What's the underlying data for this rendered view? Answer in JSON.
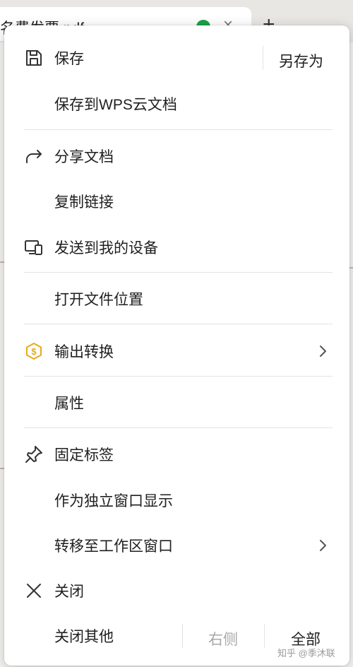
{
  "background": {
    "tab_title": "名费发票.pdf"
  },
  "menu": {
    "save": "保存",
    "save_as": "另存为",
    "save_to_cloud": "保存到WPS云文档",
    "share_doc": "分享文档",
    "copy_link": "复制链接",
    "send_to_device": "发送到我的设备",
    "open_location": "打开文件位置",
    "export_convert": "输出转换",
    "properties": "属性",
    "pin_tab": "固定标签",
    "show_independent_window": "作为独立窗口显示",
    "move_to_workspace": "转移至工作区窗口",
    "close": "关闭",
    "close_others": "关闭其他",
    "close_right": "右侧",
    "close_all": "全部"
  },
  "watermark": "知乎 @季沐联",
  "colors": {
    "accent_gold": "#e8a91b",
    "disabled_text": "#a8a8a8",
    "check_green": "#1aa34a"
  },
  "icons": {
    "save": "save-icon",
    "share": "share-icon",
    "send_device": "device-icon",
    "convert": "convert-icon",
    "pin": "pin-icon",
    "close": "close-icon"
  }
}
